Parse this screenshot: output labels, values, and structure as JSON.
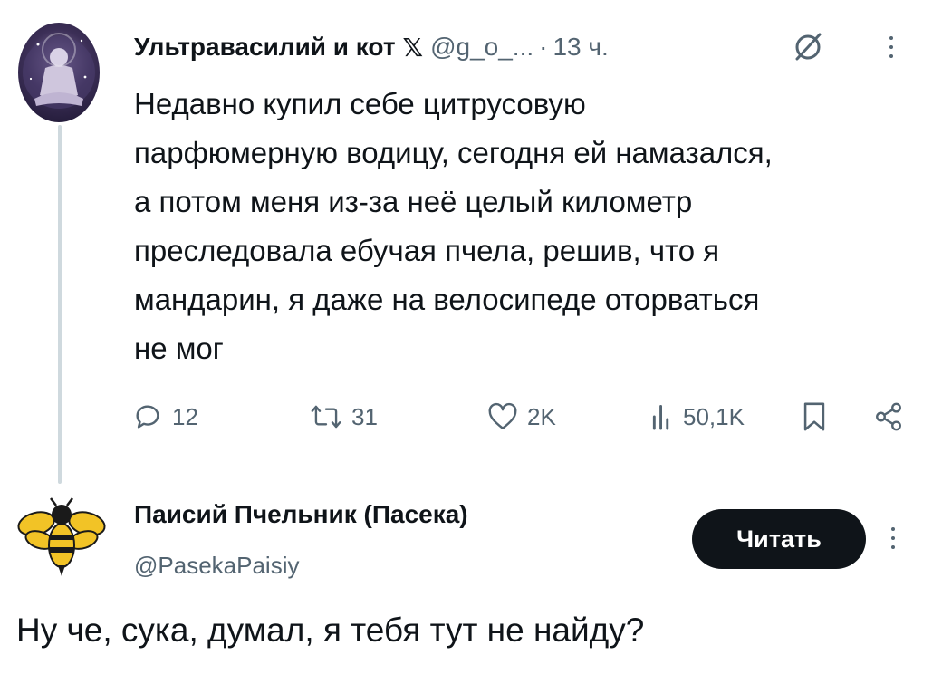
{
  "tweet": {
    "author_name": "Ультравасилий и кот",
    "x_logo": "𝕏",
    "handle": "@g_o_...",
    "separator": "·",
    "time": "13 ч.",
    "text_lines": [
      "Недавно купил себе цитрусовую",
      "парфюмерную водицу, сегодня ей намазался,",
      "а потом меня из-за неё целый километр",
      "преследовала ебучая пчела, решив, что я",
      "мандарин, я даже на велосипеде оторваться",
      "не мог"
    ],
    "actions": {
      "replies": "12",
      "reposts": "31",
      "likes": "2K",
      "views": "50,1K"
    }
  },
  "reply_account": {
    "name": "Паисий Пчельник (Пасека)",
    "handle": "@PasekaPaisiy",
    "follow_label": "Читать",
    "avatar_icon": "bee-icon"
  },
  "reply_text": "Ну че, сука, думал, я тебя тут не найду?",
  "colors": {
    "text": "#0f1419",
    "secondary": "#536471",
    "thread_line": "#cfd9de",
    "button_bg": "#0f1419"
  }
}
